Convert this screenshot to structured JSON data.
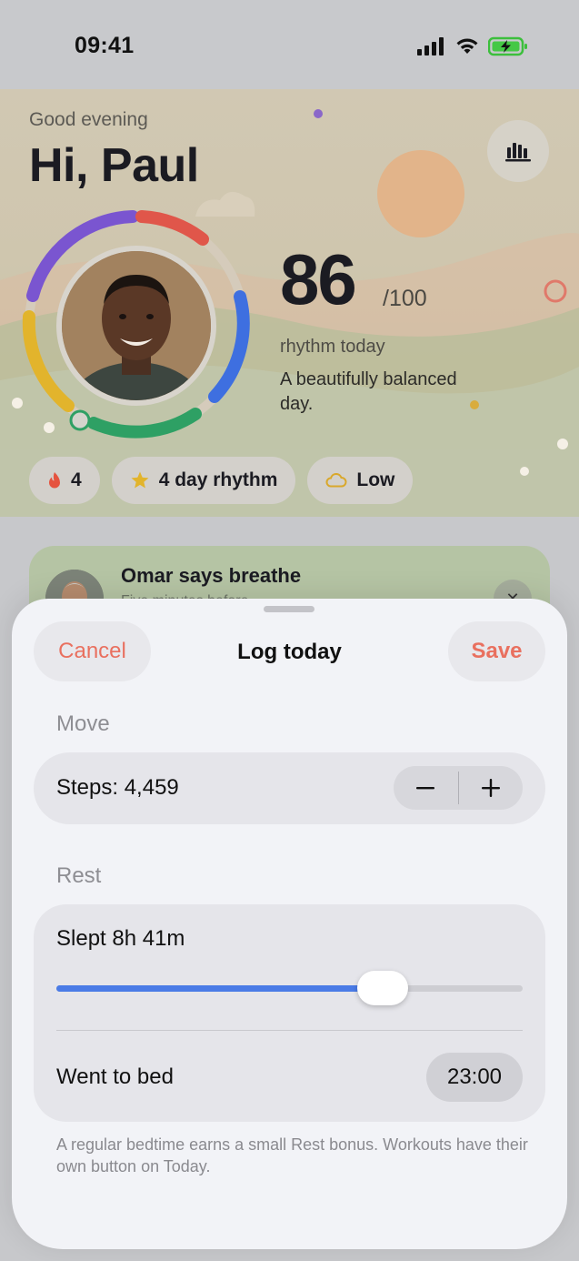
{
  "status_bar": {
    "time": "09:41"
  },
  "hero": {
    "greeting": "Good evening",
    "hello": "Hi, Paul",
    "score": "86",
    "score_max": "/100",
    "score_label": "rhythm today",
    "score_description": "A beautifully balanced day."
  },
  "chips": [
    {
      "icon": "flame-icon",
      "label": "4"
    },
    {
      "icon": "star-icon",
      "label": "4 day rhythm"
    },
    {
      "icon": "cloud-icon",
      "label": "Low"
    }
  ],
  "notice": {
    "title": "Omar says breathe",
    "subtitle": "Five minutes before"
  },
  "sheet": {
    "title": "Log today",
    "cancel_label": "Cancel",
    "save_label": "Save",
    "move_section": "Move",
    "steps_text": "Steps: 4,459",
    "rest_section": "Rest",
    "slept_text": "Slept 8h 41m",
    "sleep_slider_fraction": 0.7,
    "bed_label": "Went to bed",
    "bed_time": "23:00",
    "footnote": "A regular bedtime earns a small Rest bonus. Workouts have their own button on Today."
  },
  "colors": {
    "accent_coral": "#e9705f",
    "slider_blue": "#4a7be6",
    "ring_purple": "#7a55d0",
    "ring_red": "#e0564a",
    "ring_blue": "#3e6fe0",
    "ring_green": "#2ea064",
    "ring_yellow": "#e2b42c"
  }
}
